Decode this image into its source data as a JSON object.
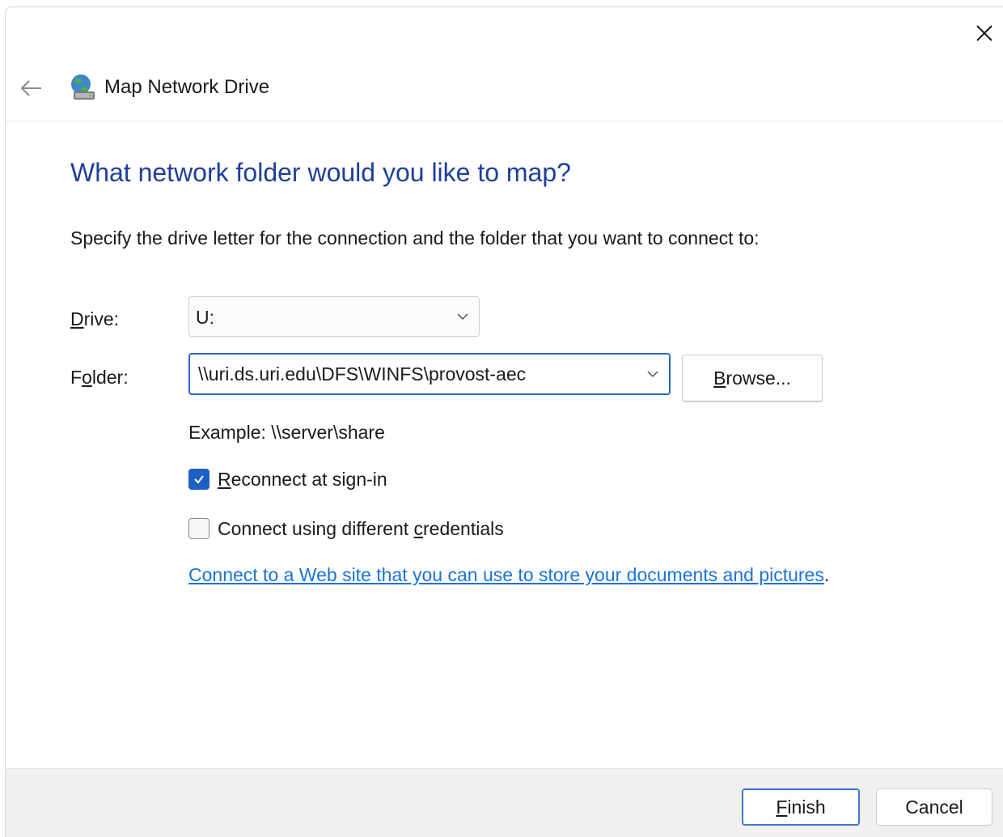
{
  "window": {
    "title": "Map Network Drive"
  },
  "page": {
    "heading": "What network folder would you like to map?",
    "instructions": "Specify the drive letter for the connection and the folder that you want to connect to:"
  },
  "drive": {
    "label_mnemonic": "D",
    "label_rest": "rive:",
    "value": "U:"
  },
  "folder": {
    "label_pre": "F",
    "label_mnemonic": "o",
    "label_rest": "lder:",
    "value": "\\\\uri.ds.uri.edu\\DFS\\WINFS\\provost-aec",
    "browse_mnemonic": "B",
    "browse_rest": "rowse...",
    "example": "Example: \\\\server\\share"
  },
  "options": {
    "reconnect_mnemonic": "R",
    "reconnect_rest": "econnect at sign-in",
    "reconnect_checked": true,
    "credentials_pre": "Connect using different ",
    "credentials_mnemonic": "c",
    "credentials_rest": "redentials",
    "credentials_checked": false
  },
  "link": {
    "text": "Connect to a Web site that you can use to store your documents and pictures",
    "trailing": "."
  },
  "footer": {
    "finish_mnemonic": "F",
    "finish_rest": "inish",
    "cancel_label": "Cancel"
  },
  "icons": {
    "close": "close-icon",
    "back": "back-arrow-icon",
    "app": "network-drive-icon",
    "dropdown": "chevron-down-icon",
    "check": "checkmark-icon"
  },
  "colors": {
    "heading": "#1f3f9a",
    "accent": "#1d5fc4",
    "link": "#1a73d9",
    "footer_bg": "#f0f0f0"
  }
}
